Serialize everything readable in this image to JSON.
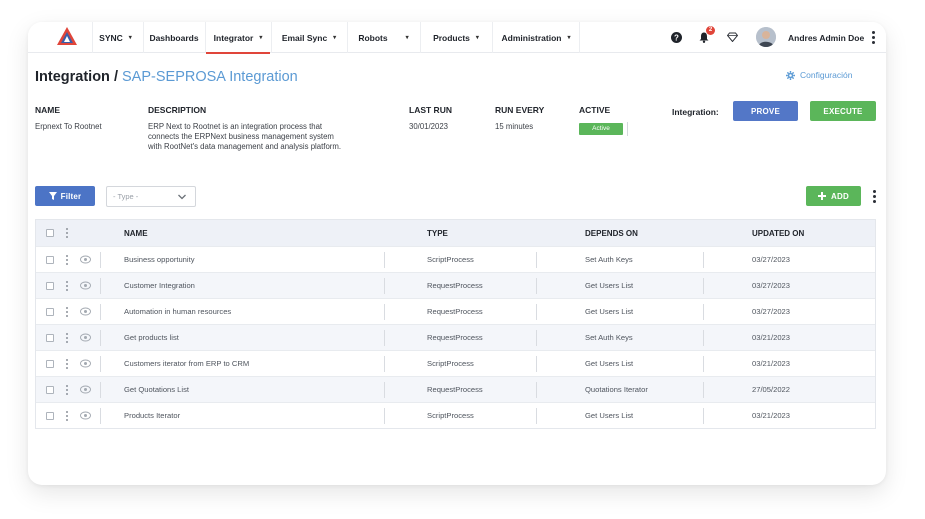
{
  "nav": {
    "items": [
      {
        "label": "SYNC",
        "caret": "▾"
      },
      {
        "label": "Dashboards",
        "caret": ""
      },
      {
        "label": "Integrator",
        "caret": "▾"
      },
      {
        "label": "Email Sync",
        "caret": "▾"
      },
      {
        "label": "Robots",
        "caret": "▾"
      },
      {
        "label": "Products",
        "caret": "▾"
      },
      {
        "label": "Administration",
        "caret": "▾"
      }
    ],
    "notification_count": "2",
    "user_name": "Andres Admin Doe"
  },
  "header": {
    "title": "Integration",
    "separator": " / ",
    "subtitle": "SAP-SEPROSA Integration",
    "config_label": "Configuración"
  },
  "info": {
    "name_label": "NAME",
    "name_value": "Erpnext To Rootnet",
    "description_label": "DESCRIPTION",
    "description_lines": [
      "ERP Next to Rootnet is an integration process that",
      "connects the ERPNext business management system",
      "with RootNet's data management and analysis platform."
    ],
    "last_run_label": "LAST RUN",
    "last_run_value": "30/01/2023",
    "run_every_label": "RUN EVERY",
    "run_every_value": "15 minutes",
    "active_label": "ACTIVE",
    "active_value": "Active",
    "integration_label": "Integration:",
    "prove_label": "PROVE",
    "execute_label": "EXECUTE"
  },
  "toolbar": {
    "filter_label": "Filter",
    "type_placeholder": "- Type -",
    "add_label": "ADD"
  },
  "table": {
    "columns": [
      "NAME",
      "TYPE",
      "DEPENDS ON",
      "UPDATED ON"
    ],
    "rows": [
      {
        "name": "Business opportunity",
        "type": "ScriptProcess",
        "depends_on": "Set Auth Keys",
        "updated_on": "03/27/2023"
      },
      {
        "name": "Customer Integration",
        "type": "RequestProcess",
        "depends_on": "Get Users List",
        "updated_on": "03/27/2023"
      },
      {
        "name": "Automation in human resources",
        "type": "RequestProcess",
        "depends_on": "Get Users List",
        "updated_on": "03/27/2023"
      },
      {
        "name": "Get products list",
        "type": "RequestProcess",
        "depends_on": "Set Auth Keys",
        "updated_on": "03/21/2023"
      },
      {
        "name": "Customers iterator from ERP to CRM",
        "type": "ScriptProcess",
        "depends_on": "Get Users List",
        "updated_on": "03/21/2023"
      },
      {
        "name": "Get Quotations List",
        "type": "RequestProcess",
        "depends_on": "Quotations Iterator",
        "updated_on": "27/05/2022"
      },
      {
        "name": "Products Iterator",
        "type": "ScriptProcess",
        "depends_on": "Get Users List",
        "updated_on": "03/21/2023"
      }
    ]
  },
  "colors": {
    "accent_red": "#e0453a",
    "link_blue": "#5b9ad4",
    "button_blue": "#5377c7",
    "button_green": "#5bb65a"
  }
}
